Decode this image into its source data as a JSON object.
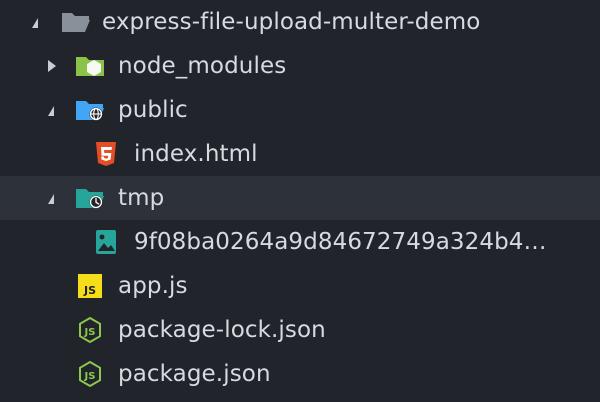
{
  "colors": {
    "background": "#21252b",
    "selected_row": "#2c313a",
    "text": "#d7dae0",
    "folder_gray": "#8a9099",
    "folder_green": "#8bc34a",
    "folder_blue": "#42a5f5",
    "folder_teal": "#26a69a",
    "html_orange": "#e44d26",
    "js_yellow": "#f5de19",
    "node_green": "#8cc84b",
    "image_teal": "#26a69a"
  },
  "tree": {
    "root": {
      "label": "express-file-upload-multer-demo",
      "icon": "folder-open-icon",
      "expanded": true
    },
    "items": [
      {
        "label": "node_modules",
        "icon": "folder-node-icon",
        "type": "folder",
        "expanded": false
      },
      {
        "label": "public",
        "icon": "folder-public-icon",
        "type": "folder",
        "expanded": true
      },
      {
        "label": "index.html",
        "icon": "html5-icon",
        "type": "file"
      },
      {
        "label": "tmp",
        "icon": "folder-temp-icon",
        "type": "folder",
        "expanded": true,
        "selected": true
      },
      {
        "label": "9f08ba0264a9d84672749a324b4…",
        "icon": "image-file-icon",
        "type": "file"
      },
      {
        "label": "app.js",
        "icon": "js-icon",
        "type": "file"
      },
      {
        "label": "package-lock.json",
        "icon": "nodejs-icon",
        "type": "file"
      },
      {
        "label": "package.json",
        "icon": "nodejs-icon",
        "type": "file"
      }
    ]
  }
}
